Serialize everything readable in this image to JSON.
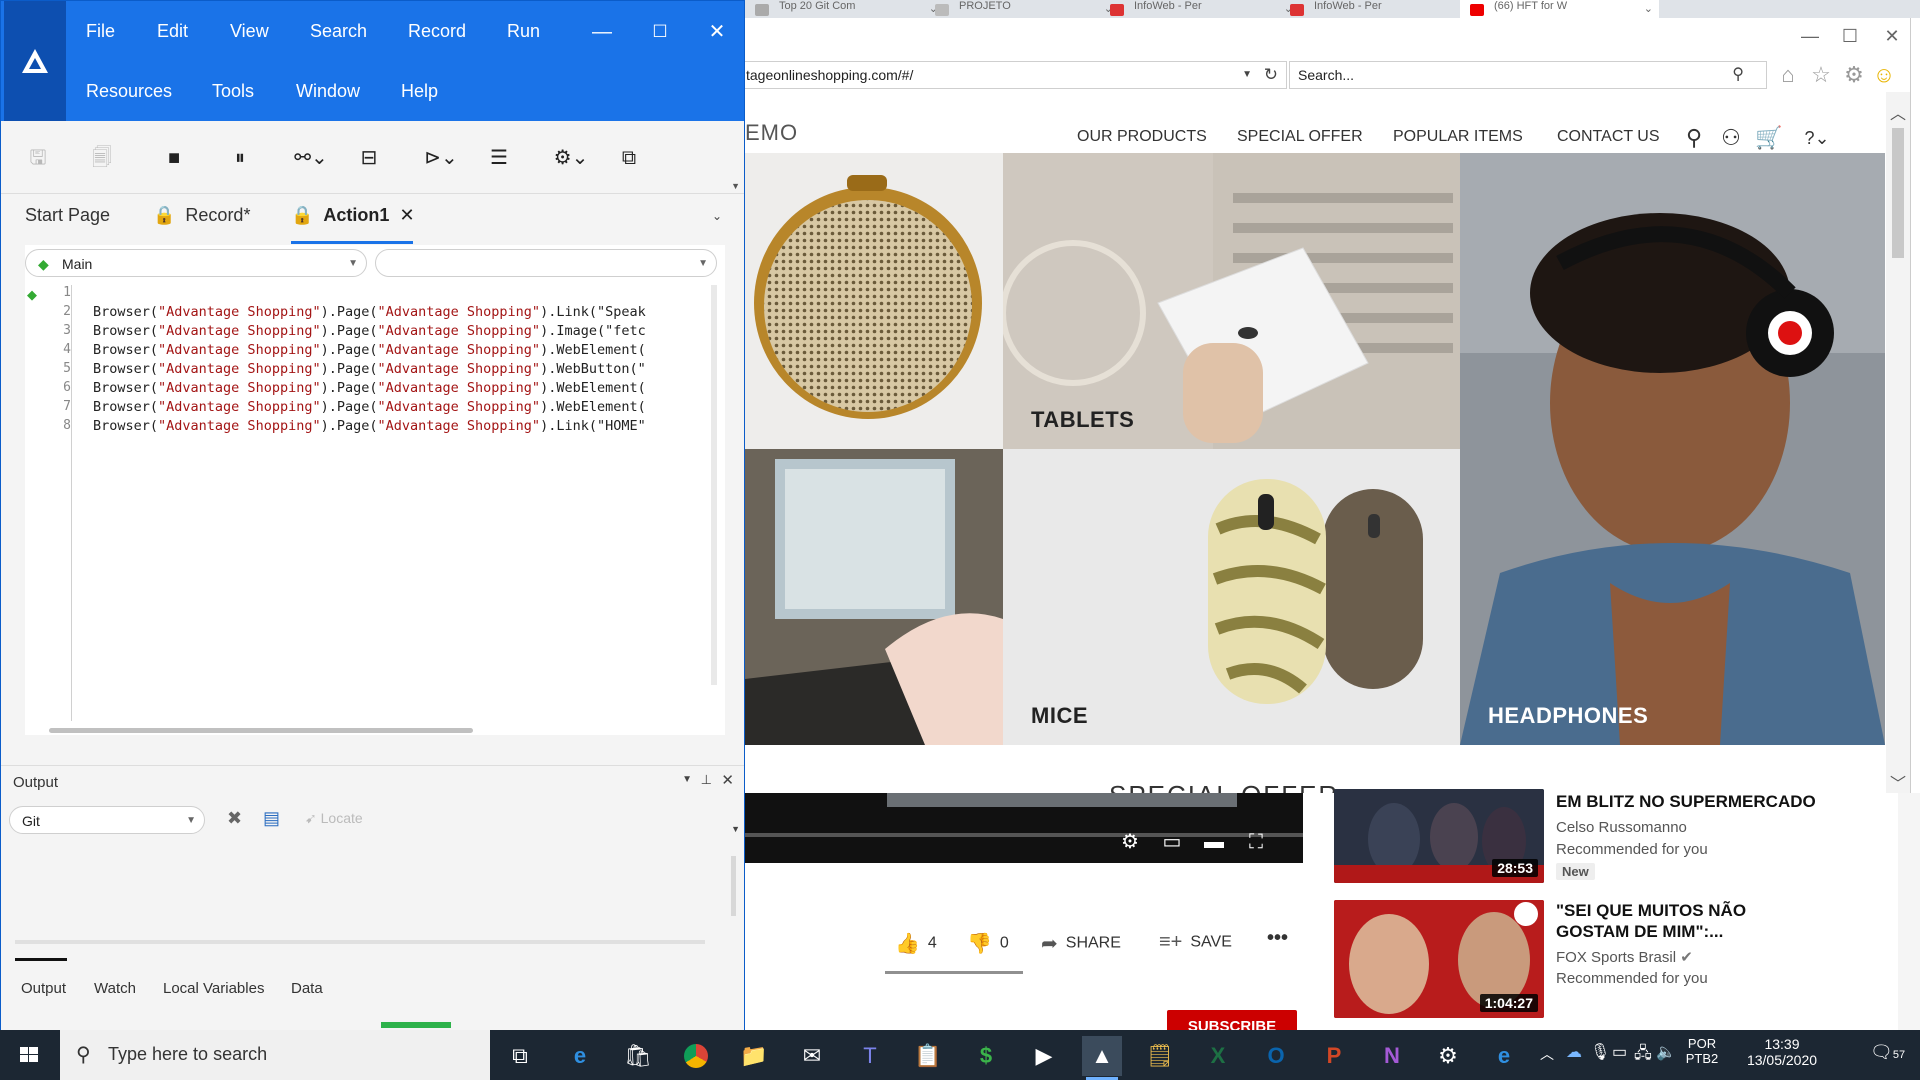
{
  "browser_tabs": [
    {
      "label": "Top 20 Git Com",
      "color": "#888"
    },
    {
      "label": "PROJETO",
      "color": "#888"
    },
    {
      "label": "InfoWeb - Per",
      "color": "#d33"
    },
    {
      "label": "InfoWeb - Per",
      "color": "#d33"
    },
    {
      "label": "(66) HFT for W",
      "color": "#e00"
    }
  ],
  "browser": {
    "url": "tageonlineshopping.com/#/",
    "search_placeholder": "Search...",
    "logo_fragment": "EMO",
    "nav": [
      "OUR PRODUCTS",
      "SPECIAL OFFER",
      "POPULAR ITEMS",
      "CONTACT US"
    ],
    "tiles": {
      "tablets": "TABLETS",
      "mice": "MICE",
      "headphones": "HEADPHONES"
    },
    "section_fragment": "SPECIAL OFFER"
  },
  "youtube": {
    "likes": "4",
    "dislikes": "0",
    "share": "SHARE",
    "save": "SAVE",
    "subscribe": "SUBSCRIBE",
    "recommendations": [
      {
        "title": "EM BLITZ NO SUPERMERCADO",
        "channel": "Celso Russomanno",
        "meta": "Recommended for you",
        "badge": "New",
        "duration": "28:53"
      },
      {
        "title": "\"SEI QUE MUITOS NÃO GOSTAM DE MIM\":...",
        "channel": "FOX Sports Brasil",
        "meta": "Recommended for you",
        "duration": "1:04:27"
      }
    ]
  },
  "ide": {
    "menu_row1": [
      "File",
      "Edit",
      "View",
      "Search",
      "Record",
      "Run"
    ],
    "menu_row2": [
      "Resources",
      "Tools",
      "Window",
      "Help"
    ],
    "tabs": [
      "Start Page",
      "Record*",
      "Action1"
    ],
    "scope_combo": "Main",
    "object_combo": "",
    "line_numbers": [
      "1",
      "2",
      "3",
      "4",
      "5",
      "6",
      "7",
      "8"
    ],
    "code_lines": [
      {
        "pre": "",
        "s1": "",
        "mid": "",
        "s2": "",
        "post": ""
      },
      {
        "pre": "Browser(",
        "s1": "\"Advantage Shopping\"",
        "mid": ").Page(",
        "s2": "\"Advantage Shopping\"",
        "post": ").Link(\"Speak"
      },
      {
        "pre": "Browser(",
        "s1": "\"Advantage Shopping\"",
        "mid": ").Page(",
        "s2": "\"Advantage Shopping\"",
        "post": ").Image(\"fetc"
      },
      {
        "pre": "Browser(",
        "s1": "\"Advantage Shopping\"",
        "mid": ").Page(",
        "s2": "\"Advantage Shopping\"",
        "post": ").WebElement("
      },
      {
        "pre": "Browser(",
        "s1": "\"Advantage Shopping\"",
        "mid": ").Page(",
        "s2": "\"Advantage Shopping\"",
        "post": ").WebButton(\""
      },
      {
        "pre": "Browser(",
        "s1": "\"Advantage Shopping\"",
        "mid": ").Page(",
        "s2": "\"Advantage Shopping\"",
        "post": ").WebElement("
      },
      {
        "pre": "Browser(",
        "s1": "\"Advantage Shopping\"",
        "mid": ").Page(",
        "s2": "\"Advantage Shopping\"",
        "post": ").WebElement("
      },
      {
        "pre": "Browser(",
        "s1": "\"Advantage Shopping\"",
        "mid": ").Page(",
        "s2": "\"Advantage Shopping\"",
        "post": ").Link(\"HOME\""
      }
    ],
    "output": {
      "title": "Output",
      "combo": "Git",
      "locate": "Locate",
      "tabs": [
        "Output",
        "Watch",
        "Local Variables",
        "Data"
      ]
    }
  },
  "taskbar": {
    "search_placeholder": "Type here to search",
    "lang_top": "POR",
    "lang_bottom": "PTB2",
    "time": "13:39",
    "date": "13/05/2020",
    "notifications": "57"
  },
  "colors": {
    "ide_blue": "#1a73e8",
    "taskbar": "#1c2733",
    "subscribe_red": "#cc0000"
  }
}
